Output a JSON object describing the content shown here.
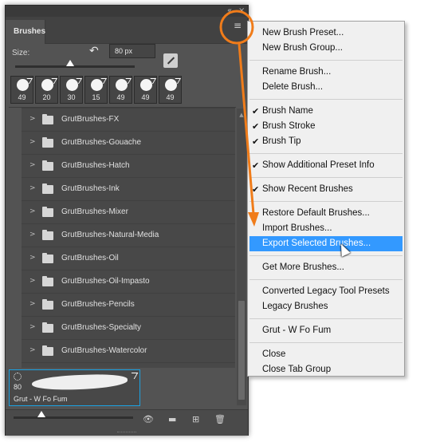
{
  "panel": {
    "strip_collapse_icon": "«",
    "strip_close_icon": "×",
    "tab_label": "Brushes",
    "menu_icon": "≡",
    "size_label": "Size:",
    "reset_icon": "↶",
    "size_value": "80 px",
    "size_slider_fraction": 0.46,
    "recent_brushes": [
      "49",
      "20",
      "30",
      "15",
      "49",
      "49",
      "49"
    ],
    "folders": [
      "GrutBrushes-FX",
      "GrutBrushes-Gouache",
      "GrutBrushes-Hatch",
      "GrutBrushes-Ink",
      "GrutBrushes-Mixer",
      "GrutBrushes-Natural-Media",
      "GrutBrushes-Oil",
      "GrutBrushes-Oil-Impasto",
      "GrutBrushes-Pencils",
      "GrutBrushes-Specialty",
      "GrutBrushes-Watercolor"
    ],
    "selected_brush": {
      "size": "80",
      "name": "Grut - W Fo Fum"
    },
    "bottom_icons": [
      "eye-icon",
      "folder-icon",
      "new-brush-icon",
      "trash-icon"
    ]
  },
  "menu": {
    "items": [
      {
        "label": "New Brush Preset...",
        "checked": false
      },
      {
        "label": "New Brush Group...",
        "checked": false
      },
      {
        "separator": true
      },
      {
        "label": "Rename Brush...",
        "checked": false
      },
      {
        "label": "Delete Brush...",
        "checked": false
      },
      {
        "separator": true
      },
      {
        "label": "Brush Name",
        "checked": true
      },
      {
        "label": "Brush Stroke",
        "checked": true
      },
      {
        "label": "Brush Tip",
        "checked": true
      },
      {
        "separator": true
      },
      {
        "label": "Show Additional Preset Info",
        "checked": true
      },
      {
        "separator": true
      },
      {
        "label": "Show Recent Brushes",
        "checked": true
      },
      {
        "separator": true
      },
      {
        "label": "Restore Default Brushes...",
        "checked": false
      },
      {
        "label": "Import Brushes...",
        "checked": false
      },
      {
        "label": "Export Selected Brushes...",
        "checked": false,
        "highlighted": true
      },
      {
        "separator": true
      },
      {
        "label": "Get More Brushes...",
        "checked": false
      },
      {
        "separator": true
      },
      {
        "label": "Converted Legacy Tool Presets",
        "checked": false
      },
      {
        "label": "Legacy Brushes",
        "checked": false
      },
      {
        "separator": true
      },
      {
        "label": "Grut - W Fo Fum",
        "checked": false
      },
      {
        "separator": true
      },
      {
        "label": "Close",
        "checked": false
      },
      {
        "label": "Close Tab Group",
        "checked": false
      }
    ],
    "check_glyph": "✔",
    "highlight_color": "#3399ff"
  },
  "annotation": {
    "color": "#f07c1a"
  }
}
